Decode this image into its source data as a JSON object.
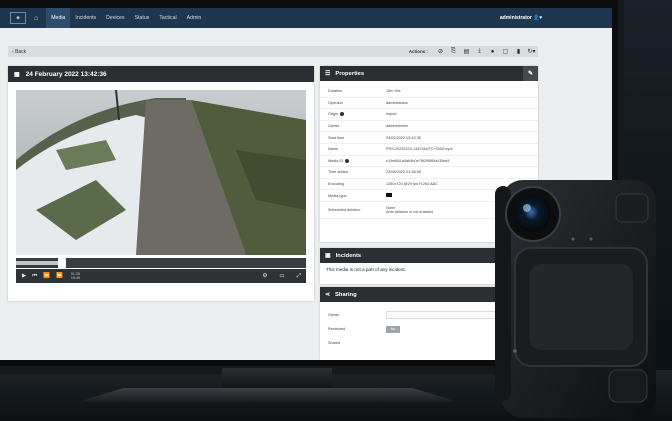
{
  "nav": {
    "items": [
      "Media",
      "Incidents",
      "Devices",
      "Status",
      "Tactical",
      "Admin"
    ],
    "active": "Media",
    "user": "administrator"
  },
  "toolbar": {
    "back": "Back",
    "actions_label": "Actions :"
  },
  "media": {
    "title": "24 February 2022 13:42:36",
    "progress": 0.09,
    "time_current": "01:35",
    "time_total": "15:49"
  },
  "properties": {
    "title": "Properties",
    "rows": [
      {
        "key": "Duration",
        "value": "15m 49s"
      },
      {
        "key": "Operator",
        "value": "administrator"
      },
      {
        "key": "Origin",
        "value": "import"
      },
      {
        "key": "Owner",
        "value": "administrator"
      },
      {
        "key": "Start time",
        "value": "24/02/2022 13:42:36"
      },
      {
        "key": "Name",
        "value": "PSS-20220224-134236UTC+0000.mp4"
      },
      {
        "key": "Media ID",
        "value": "e19ef641a0a64b0e7f6295f84e1f3ee5"
      },
      {
        "key": "Time added",
        "value": "23/08/2022 21:38:58"
      },
      {
        "key": "Encoding",
        "value": "1280x720 @29 fps H.264 AAC"
      },
      {
        "key": "Media type",
        "value": ""
      },
      {
        "key": "Scheduled deletion",
        "value": "None"
      }
    ],
    "scheduled_deletion_note": "Auto deletion is not enabled"
  },
  "incidents": {
    "title": "Incidents",
    "text": "This media is not a part of any incident."
  },
  "sharing": {
    "title": "Sharing",
    "owner_label": "Owner",
    "restricted_label": "Restricted",
    "restricted_value": "No",
    "shared_label": "Shared"
  }
}
